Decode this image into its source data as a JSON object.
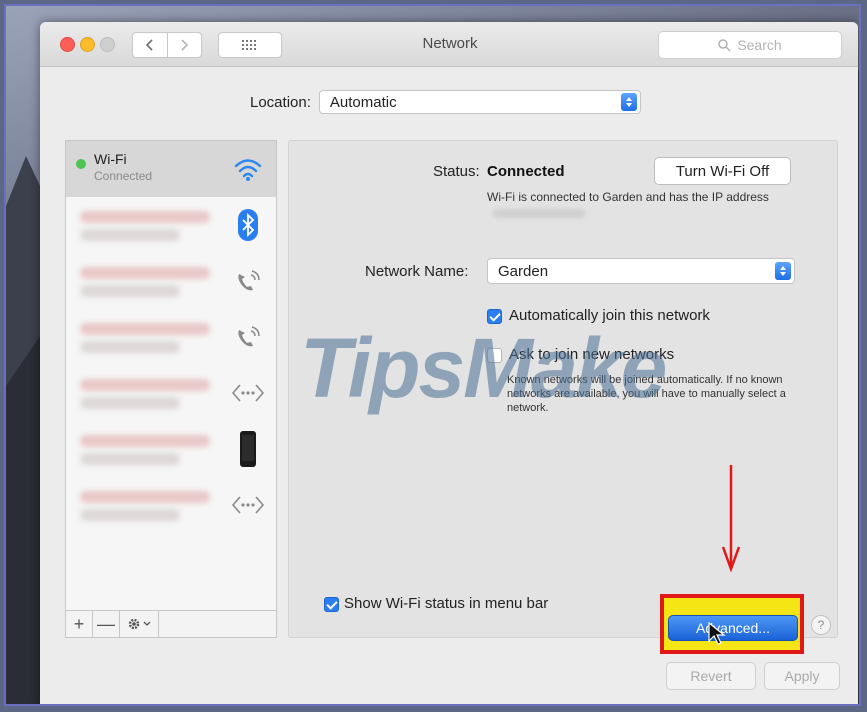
{
  "window": {
    "title": "Network"
  },
  "search": {
    "placeholder": "Search"
  },
  "location": {
    "label": "Location:",
    "value": "Automatic"
  },
  "sidebar": {
    "items": [
      {
        "name": "Wi-Fi",
        "status": "Connected",
        "icon": "wifi-icon",
        "dot_color": "#4cc552"
      },
      {
        "icon": "bluetooth-icon",
        "dot_color": "#e4b0b0"
      },
      {
        "icon": "phone-icon",
        "dot_color": "#e4b0b0"
      },
      {
        "icon": "phone-icon",
        "dot_color": "#e4b0b0"
      },
      {
        "icon": "ethernet-arrows-icon",
        "dot_color": "#e4b0b0"
      },
      {
        "icon": "iphone-device-icon",
        "dot_color": "#e4b0b0"
      },
      {
        "icon": "ethernet-arrows-icon",
        "dot_color": "#e4b0b0"
      }
    ],
    "footer": {
      "add": "+",
      "remove": "—"
    }
  },
  "detail": {
    "status_label": "Status:",
    "status_value": "Connected",
    "turn_off_label": "Turn Wi-Fi Off",
    "status_description": "Wi-Fi is connected to Garden and has the IP address",
    "network_name_label": "Network Name:",
    "network_name_value": "Garden",
    "auto_join_label": "Automatically join this network",
    "auto_join_checked": true,
    "ask_join_label": "Ask to join new networks",
    "ask_join_checked": false,
    "ask_join_description": "Known networks will be joined automatically. If no known networks are available, you will have to manually select a network."
  },
  "bottom": {
    "show_status_label": "Show Wi-Fi status in menu bar",
    "show_status_checked": true,
    "advanced_label": "Advanced...",
    "help_label": "?",
    "revert_label": "Revert",
    "apply_label": "Apply"
  },
  "watermark": {
    "text": "TipsMake"
  },
  "colors": {
    "accent": "#2b7ef0",
    "highlight_border": "#e01818",
    "highlight_fill": "#f6e514",
    "annotation_arrow": "#e01818"
  }
}
